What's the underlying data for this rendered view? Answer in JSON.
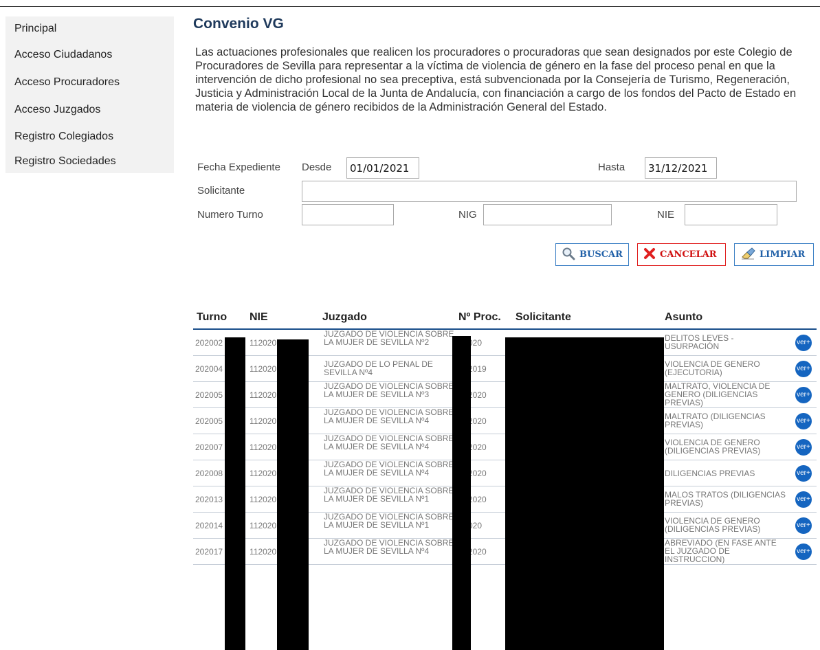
{
  "sidebar": {
    "items": [
      {
        "label": "Principal"
      },
      {
        "label": "Acceso Ciudadanos"
      },
      {
        "label": "Acceso Procuradores"
      },
      {
        "label": "Acceso Juzgados"
      },
      {
        "label": "Registro Colegiados"
      },
      {
        "label": "Registro Sociedades"
      }
    ]
  },
  "page": {
    "title": "Convenio VG",
    "intro": "Las actuaciones profesionales que realicen los procuradores o procuradoras que sean designados por este Colegio de Procuradores de Sevilla para representar a la víctima de violencia de género en la fase del proceso penal en que la intervención de dicho profesional no sea preceptiva, está subvencionada por la Consejería de Turismo, Regeneración, Justicia y Administración Local de la Junta de Andalucía, con financiación a cargo de los fondos del Pacto de Estado en materia de violencia de género recibidos de la Administración General del Estado."
  },
  "filters": {
    "fecha_label": "Fecha Expediente",
    "desde_label": "Desde",
    "desde_value": "01/01/2021",
    "hasta_label": "Hasta",
    "hasta_value": "31/12/2021",
    "solicitante_label": "Solicitante",
    "solicitante_value": "",
    "numero_turno_label": "Numero Turno",
    "numero_turno_value": "",
    "nig_label": "NIG",
    "nig_value": "",
    "nie_label": "NIE",
    "nie_value": ""
  },
  "buttons": {
    "buscar": "BUSCAR",
    "cancelar": "CANCELAR",
    "limpiar": "LIMPIAR"
  },
  "icons": {
    "buscar": "magnifier-icon",
    "cancelar": "x-icon",
    "limpiar": "eraser-icon",
    "ver": "ver-plus-icon"
  },
  "colors": {
    "title": "#1f3a5c",
    "accent_blue": "#1565c0",
    "cancel_red": "#e02020"
  },
  "table": {
    "headers": [
      "Turno",
      "NIE",
      "Juzgado",
      "Nº Proc.",
      "Solicitante",
      "Asunto"
    ],
    "ver_label": "ver+",
    "rows": [
      {
        "turno": "202002",
        "nie": "112020",
        "juzgado": "JUZGADO DE VIOLENCIA SOBRE LA MUJER DE SEVILLA Nº2",
        "proc": "/2020",
        "asunto": "DELITOS LEVES - USURPACIÓN"
      },
      {
        "turno": "202004",
        "nie": "112020",
        "juzgado": "JUZGADO DE LO PENAL DE SEVILLA Nº4",
        "proc": "6/2019",
        "asunto": "VIOLENCIA DE GENERO (EJECUTORIA)"
      },
      {
        "turno": "202005",
        "nie": "112020",
        "juzgado": "JUZGADO DE VIOLENCIA SOBRE LA MUJER DE SEVILLA Nº3",
        "proc": "3/2020",
        "asunto": "MALTRATO, VIOLENCIA DE GENERO (DILIGENCIAS PREVIAS)"
      },
      {
        "turno": "202005",
        "nie": "112020",
        "juzgado": "JUZGADO DE VIOLENCIA SOBRE LA MUJER DE SEVILLA Nº4",
        "proc": "3/2020",
        "asunto": "MALTRATO (DILIGENCIAS PREVIAS)"
      },
      {
        "turno": "202007",
        "nie": "112020",
        "juzgado": "JUZGADO DE VIOLENCIA SOBRE LA MUJER DE SEVILLA Nº4",
        "proc": "2/2020",
        "asunto": "VIOLENCIA DE GENERO (DILIGENCIAS PREVIAS)"
      },
      {
        "turno": "202008",
        "nie": "112020",
        "juzgado": "JUZGADO DE VIOLENCIA SOBRE LA MUJER DE SEVILLA Nº4",
        "proc": "2/2020",
        "asunto": "DILIGENCIAS PREVIAS"
      },
      {
        "turno": "202013",
        "nie": "112020",
        "juzgado": "JUZGADO DE VIOLENCIA SOBRE LA MUJER DE SEVILLA Nº1",
        "proc": "9/2020",
        "asunto": "MALOS TRATOS (DILIGENCIAS PREVIAS)"
      },
      {
        "turno": "202014",
        "nie": "112020",
        "juzgado": "JUZGADO DE VIOLENCIA SOBRE LA MUJER DE SEVILLA Nº1",
        "proc": "/2020",
        "asunto": "VIOLENCIA DE GENERO (DILIGENCIAS PREVIAS)"
      },
      {
        "turno": "202017",
        "nie": "112020",
        "juzgado": "JUZGADO DE VIOLENCIA SOBRE LA MUJER DE SEVILLA Nº4",
        "proc": "3/2020",
        "asunto": "ABREVIADO (EN FASE ANTE EL JUZGADO DE INSTRUCCION)"
      }
    ]
  }
}
